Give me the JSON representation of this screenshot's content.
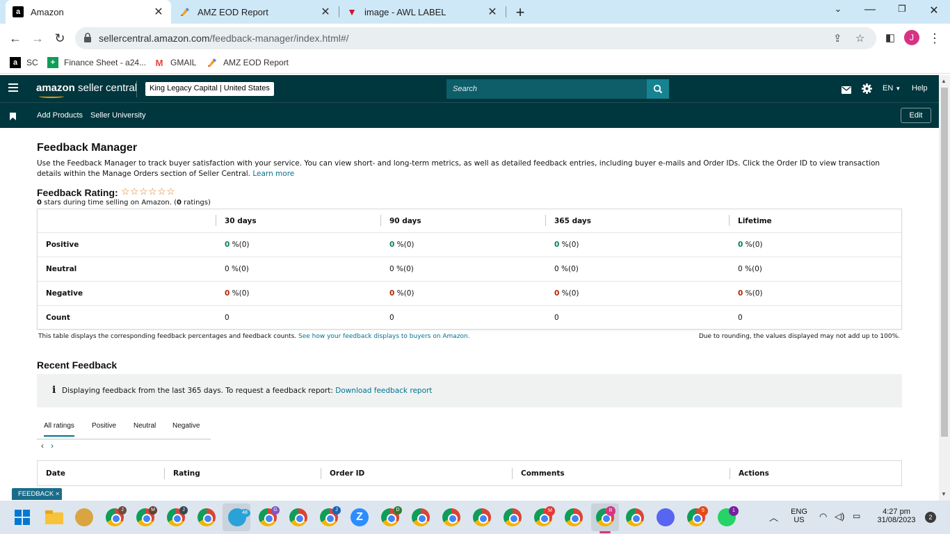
{
  "browser": {
    "tabs": [
      {
        "title": "Amazon",
        "favicon": "amazon-a-icon"
      },
      {
        "title": "AMZ EOD Report",
        "favicon": "multicolor-pencil-icon"
      },
      {
        "title": "image - AWL LABEL",
        "favicon": "red-v-icon"
      }
    ],
    "url_host": "sellercentral.amazon.com",
    "url_path": "/feedback-manager/index.html#/",
    "profile_initial": "J",
    "bookmarks": [
      {
        "label": "SC",
        "icon": "amazon-a-icon"
      },
      {
        "label": "Finance Sheet - a24...",
        "icon": "sheets-plus-icon"
      },
      {
        "label": "GMAIL",
        "icon": "gmail-icon"
      },
      {
        "label": "AMZ EOD Report",
        "icon": "multicolor-pencil-icon"
      }
    ]
  },
  "header": {
    "logo_bold": "amazon",
    "logo_rest": " seller central",
    "store": "King Legacy Capital | United States",
    "search_placeholder": "Search",
    "language": "EN",
    "help": "Help",
    "bookmark_links": [
      "Add Products",
      "Seller University"
    ],
    "edit": "Edit"
  },
  "page": {
    "title": "Feedback Manager",
    "description": "Use the Feedback Manager to track buyer satisfaction with your service. You can view short- and long-term metrics, as well as detailed feedback entries, including buyer e-mails and Order IDs. Click the Order ID to view transaction details within the Manage Orders section of Seller Central.",
    "learn_more": "Learn more",
    "rating_title": "Feedback Rating:",
    "stars": "☆☆☆☆☆☆",
    "rating_stars_count": "0",
    "rating_mid": " stars during time selling on Amazon. (",
    "rating_count": "0",
    "rating_end": " ratings)"
  },
  "feedback_table": {
    "columns": [
      "30 days",
      "90 days",
      "365 days",
      "Lifetime"
    ],
    "rows": [
      {
        "label": "Positive",
        "cells": [
          "0",
          "0",
          "0",
          "0"
        ],
        "suffix": " %(0)"
      },
      {
        "label": "Neutral",
        "cells": [
          "0",
          "0",
          "0",
          "0"
        ],
        "suffix": " %(0)"
      },
      {
        "label": "Negative",
        "cells": [
          "0",
          "0",
          "0",
          "0"
        ],
        "suffix": " %(0)"
      },
      {
        "label": "Count",
        "cells": [
          "0",
          "0",
          "0",
          "0"
        ],
        "suffix": ""
      }
    ],
    "note_left": "This table displays the corresponding feedback percentages and feedback counts.",
    "note_link": "See how your feedback displays to buyers on Amazon.",
    "note_right": "Due to rounding, the values displayed may not add up to 100%."
  },
  "recent": {
    "title": "Recent Feedback",
    "info_text": "Displaying feedback from the last 365 days. To request a feedback report:",
    "info_link": "Download feedback report",
    "tabs": [
      "All ratings",
      "Positive",
      "Neutral",
      "Negative"
    ],
    "columns": [
      "Date",
      "Rating",
      "Order ID",
      "Comments",
      "Actions"
    ]
  },
  "feedback_tag": "FEEDBACK ×",
  "taskbar": {
    "lang_top": "ENG",
    "lang_bottom": "US",
    "time": "4:27 pm",
    "date": "31/08/2023",
    "notifications": "2",
    "telegram_badge": "48",
    "badges": [
      "J",
      "M",
      "J",
      "G",
      "J",
      "D",
      "M",
      "R",
      "M",
      "R",
      "5",
      "1"
    ]
  }
}
